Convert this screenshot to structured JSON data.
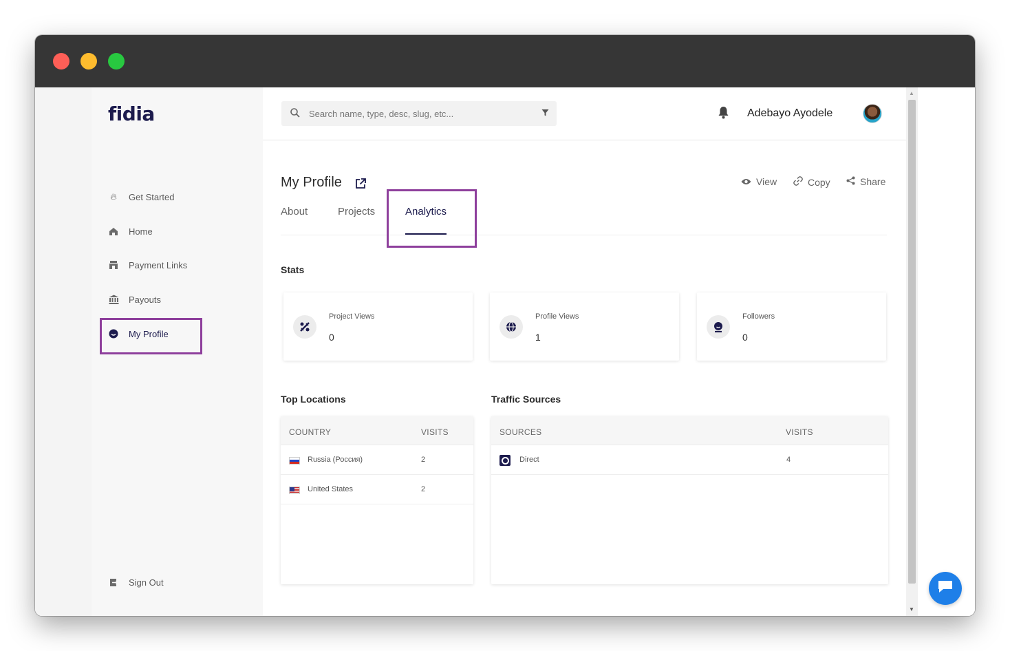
{
  "window": {
    "controls": [
      "close",
      "minimize",
      "maximize"
    ]
  },
  "brand": {
    "logo_text": "fidia"
  },
  "sidebar": {
    "items": [
      {
        "label": "Get Started",
        "icon": "flame-icon"
      },
      {
        "label": "Home",
        "icon": "home-icon"
      },
      {
        "label": "Payment Links",
        "icon": "store-icon"
      },
      {
        "label": "Payouts",
        "icon": "bank-icon"
      },
      {
        "label": "My Profile",
        "icon": "profile-icon",
        "active": true
      }
    ],
    "signout": {
      "label": "Sign Out",
      "icon": "sign-out-icon"
    }
  },
  "header": {
    "search_placeholder": "Search name, type, desc, slug, etc...",
    "username": "Adebayo Ayodele"
  },
  "page": {
    "title": "My Profile",
    "actions": {
      "view": "View",
      "copy": "Copy",
      "share": "Share"
    },
    "tabs": [
      {
        "label": "About"
      },
      {
        "label": "Projects"
      },
      {
        "label": "Analytics",
        "active": true
      }
    ]
  },
  "stats": {
    "heading": "Stats",
    "cards": [
      {
        "label": "Project Views",
        "value": "0",
        "icon": "project-icon"
      },
      {
        "label": "Profile Views",
        "value": "1",
        "icon": "globe-icon"
      },
      {
        "label": "Followers",
        "value": "0",
        "icon": "follower-icon"
      }
    ]
  },
  "locations": {
    "heading": "Top Locations",
    "columns": [
      "COUNTRY",
      "VISITS"
    ],
    "rows": [
      {
        "country": "Russia (Россия)",
        "visits": "2",
        "flag": "ru"
      },
      {
        "country": "United States",
        "visits": "2",
        "flag": "us"
      }
    ]
  },
  "traffic": {
    "heading": "Traffic Sources",
    "columns": [
      "SOURCES",
      "VISITS"
    ],
    "rows": [
      {
        "source": "Direct",
        "visits": "4"
      }
    ]
  },
  "colors": {
    "accent": "#1c1b4d",
    "highlight": "#8e3f9c",
    "chat": "#1e7fe8"
  }
}
